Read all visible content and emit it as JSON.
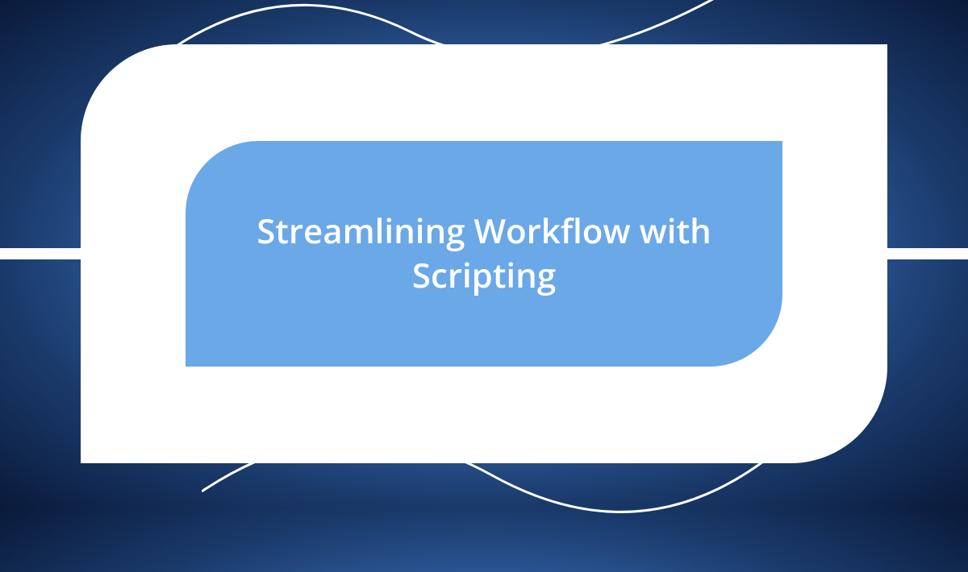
{
  "title": "Streamlining Workflow with Scripting"
}
